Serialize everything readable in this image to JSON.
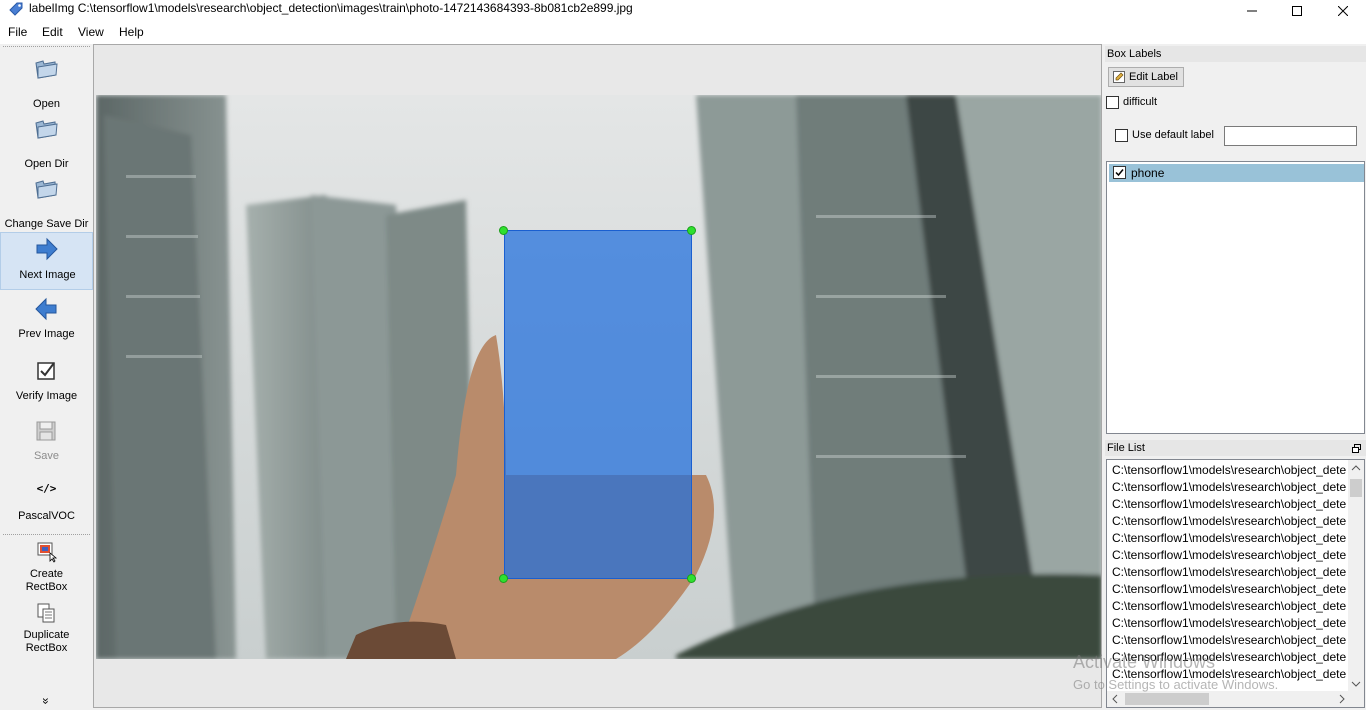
{
  "window": {
    "title": "labelImg C:\\tensorflow1\\models\\research\\object_detection\\images\\train\\photo-1472143684393-8b081cb2e899.jpg"
  },
  "menu": [
    "File",
    "Edit",
    "View",
    "Help"
  ],
  "toolbar": {
    "open": "Open",
    "open_dir": "Open Dir",
    "change_save_dir": "Change Save Dir",
    "next_image": "Next Image",
    "prev_image": "Prev Image",
    "verify_image": "Verify Image",
    "save": "Save",
    "format_icon_text": "</>",
    "format": "PascalVOC",
    "create_rectbox_1": "Create",
    "create_rectbox_2": "RectBox",
    "duplicate_rectbox_1": "Duplicate",
    "duplicate_rectbox_2": "RectBox",
    "more": "»"
  },
  "box_labels": {
    "title": "Box Labels",
    "edit_label": "Edit Label",
    "difficult": "difficult",
    "use_default_label": "Use default label",
    "default_label_value": "",
    "labels": [
      {
        "name": "phone",
        "checked": true
      }
    ]
  },
  "file_list": {
    "title": "File List",
    "items": [
      "C:\\tensorflow1\\models\\research\\object_dete",
      "C:\\tensorflow1\\models\\research\\object_dete",
      "C:\\tensorflow1\\models\\research\\object_dete",
      "C:\\tensorflow1\\models\\research\\object_dete",
      "C:\\tensorflow1\\models\\research\\object_dete",
      "C:\\tensorflow1\\models\\research\\object_dete",
      "C:\\tensorflow1\\models\\research\\object_dete",
      "C:\\tensorflow1\\models\\research\\object_dete",
      "C:\\tensorflow1\\models\\research\\object_dete",
      "C:\\tensorflow1\\models\\research\\object_dete",
      "C:\\tensorflow1\\models\\research\\object_dete",
      "C:\\tensorflow1\\models\\research\\object_dete",
      "C:\\tensorflow1\\models\\research\\object_dete"
    ]
  },
  "watermark": {
    "line1": "Activate Windows",
    "line2": "Go to Settings to activate Windows."
  },
  "colors": {
    "bbox_fill": "#1e6edc",
    "handle": "#2fe02f",
    "selected_label": "#99c2d8",
    "active_tool": "#d6e4f4"
  }
}
